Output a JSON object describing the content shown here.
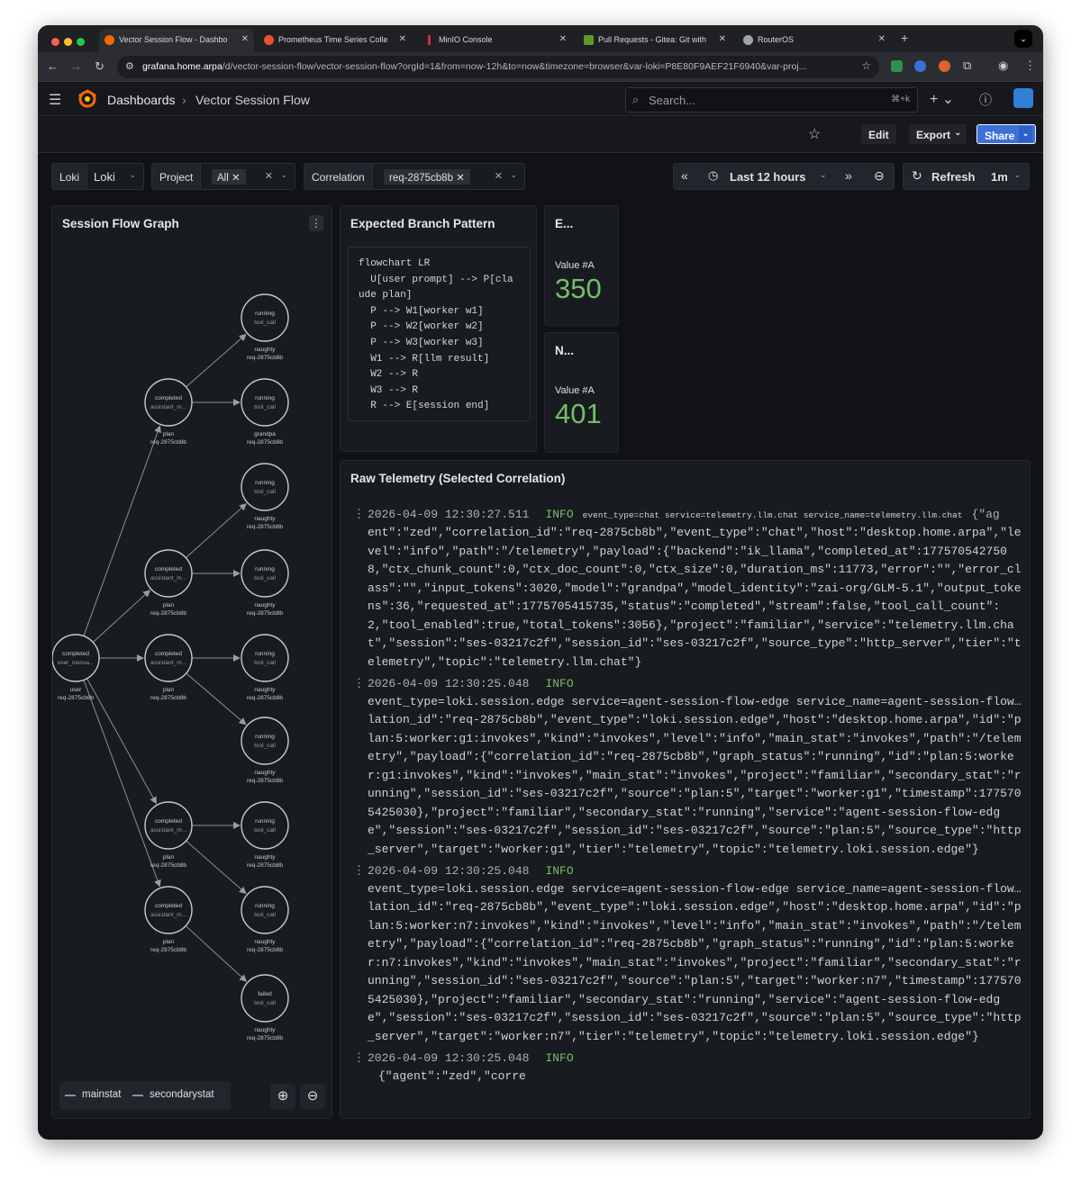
{
  "browser": {
    "tabs": [
      {
        "title": "Vector Session Flow - Dashbo",
        "color": "#f46800"
      },
      {
        "title": "Prometheus Time Series Colle",
        "color": "#e6522c"
      },
      {
        "title": "MinIO Console",
        "color": "#c72c48"
      },
      {
        "title": "Pull Requests - Gitea: Git with",
        "color": "#609926"
      },
      {
        "title": "RouterOS",
        "color": "#9ea3ad"
      }
    ],
    "url_host": "grafana.home.arpa",
    "url_rest": "/d/vector-session-flow/vector-session-flow?orgId=1&from=now-12h&to=now&timezone=browser&var-loki=P8E80F9AEF21F6940&var-proj..."
  },
  "header": {
    "breadcrumb_root": "Dashboards",
    "breadcrumb_current": "Vector Session Flow",
    "search_placeholder": "Search...",
    "search_shortcut": "⌘+k"
  },
  "toolbar": {
    "edit": "Edit",
    "export": "Export",
    "share": "Share"
  },
  "variables": {
    "loki": {
      "label": "Loki",
      "value": "Loki"
    },
    "project": {
      "label": "Project",
      "value": "All"
    },
    "correlation": {
      "label": "Correlation",
      "value": "req-2875cb8b"
    }
  },
  "timepicker": {
    "range": "Last 12 hours",
    "refresh": "Refresh",
    "interval": "1m"
  },
  "graph_panel": {
    "title": "Session Flow Graph",
    "nodes": [
      {
        "id": "user",
        "main": "completed",
        "sec": "user_messa...",
        "title": "user",
        "sub": "req-2875cb8b"
      },
      {
        "id": "a1",
        "main": "completed",
        "sec": "assistant_m...",
        "title": "plan",
        "sub": "req-2875cb8b"
      },
      {
        "id": "a2",
        "main": "completed",
        "sec": "assistant_m...",
        "title": "plan",
        "sub": "req-2875cb8b"
      },
      {
        "id": "a3",
        "main": "completed",
        "sec": "assistant_m...",
        "title": "plan",
        "sub": "req-2875cb8b"
      },
      {
        "id": "a4",
        "main": "completed",
        "sec": "assistant_m...",
        "title": "plan",
        "sub": "req-2875cb8b"
      },
      {
        "id": "a5",
        "main": "completed",
        "sec": "assistant_m...",
        "title": "plan",
        "sub": "req-2875cb8b"
      },
      {
        "id": "t1",
        "main": "running",
        "sec": "tool_call",
        "title": "naughty",
        "sub": "req-2875cb8b"
      },
      {
        "id": "t2",
        "main": "running",
        "sec": "tool_call",
        "title": "grandpa",
        "sub": "req-2875cb8b"
      },
      {
        "id": "t3",
        "main": "running",
        "sec": "tool_call",
        "title": "naughty",
        "sub": "req-2875cb8b"
      },
      {
        "id": "t4",
        "main": "running",
        "sec": "tool_call",
        "title": "naughty",
        "sub": "req-2875cb8b"
      },
      {
        "id": "t5",
        "main": "running",
        "sec": "tool_call",
        "title": "naughty",
        "sub": "req-2875cb8b"
      },
      {
        "id": "t6",
        "main": "running",
        "sec": "tool_call",
        "title": "naughty",
        "sub": "req-2875cb8b"
      },
      {
        "id": "t7",
        "main": "running",
        "sec": "tool_call",
        "title": "naughty",
        "sub": "req-2875cb8b"
      },
      {
        "id": "t8",
        "main": "running",
        "sec": "tool_call",
        "title": "naughty",
        "sub": "req-2875cb8b"
      },
      {
        "id": "t9",
        "main": "failed",
        "sec": "tool_call",
        "title": "naughty",
        "sub": "req-2875cb8b"
      }
    ],
    "edges": [
      [
        "user",
        "a1"
      ],
      [
        "user",
        "a2"
      ],
      [
        "user",
        "a3"
      ],
      [
        "user",
        "a4"
      ],
      [
        "user",
        "a5"
      ],
      [
        "a1",
        "t1"
      ],
      [
        "a1",
        "t2"
      ],
      [
        "a2",
        "t3"
      ],
      [
        "a2",
        "t4"
      ],
      [
        "a3",
        "t5"
      ],
      [
        "a3",
        "t6"
      ],
      [
        "a4",
        "t7"
      ],
      [
        "a4",
        "t8"
      ],
      [
        "a5",
        "t9"
      ]
    ],
    "legend": [
      "mainstat",
      "secondarystat"
    ]
  },
  "pattern_panel": {
    "title": "Expected Branch Pattern",
    "code": "flowchart LR\n  U[user prompt] --> P[cla\nude plan]\n  P --> W1[worker w1]\n  P --> W2[worker w2]\n  P --> W3[worker w3]\n  W1 --> R[llm result]\n  W2 --> R\n  W3 --> R\n  R --> E[session end]"
  },
  "stat_panels": [
    {
      "title": "E...",
      "label": "Value #A",
      "value": "350"
    },
    {
      "title": "N...",
      "label": "Value #A",
      "value": "401"
    }
  ],
  "logs_panel": {
    "title": "Raw Telemetry (Selected Correlation)",
    "entries": [
      {
        "ts": "2026-04-09 12:30:27.511",
        "level": "INFO",
        "labels": "event_type=chat service=telemetry.llm.chat service_name=telemetry.llm.chat",
        "lead": "{\"ag",
        "body": "ent\":\"zed\",\"correlation_id\":\"req-2875cb8b\",\"event_type\":\"chat\",\"host\":\"desktop.home.arpa\",\"level\":\"info\",\"path\":\"/telemetry\",\"payload\":{\"backend\":\"ik_llama\",\"completed_at\":1775705427508,\"ctx_chunk_count\":0,\"ctx_doc_count\":0,\"ctx_size\":0,\"duration_ms\":11773,\"error\":\"\",\"error_class\":\"\",\"input_tokens\":3020,\"model\":\"grandpa\",\"model_identity\":\"zai-org/GLM-5.1\",\"output_tokens\":36,\"requested_at\":1775705415735,\"status\":\"completed\",\"stream\":false,\"tool_call_count\":2,\"tool_enabled\":true,\"total_tokens\":3056},\"project\":\"familiar\",\"service\":\"telemetry.llm.chat\",\"session\":\"ses-03217c2f\",\"session_id\":\"ses-03217c2f\",\"source_type\":\"http_server\",\"tier\":\"telemetry\",\"topic\":\"telemetry.llm.chat\"}"
      },
      {
        "ts": "2026-04-09 12:30:25.048",
        "level": "INFO",
        "labels": "event_type=loki.session.edge service=agent-session-flow-edge service_name=agent-session-flow…",
        "lead": "{\"agent\":\"zed\",\"corre",
        "body": "lation_id\":\"req-2875cb8b\",\"event_type\":\"loki.session.edge\",\"host\":\"desktop.home.arpa\",\"id\":\"plan:5:worker:g1:invokes\",\"kind\":\"invokes\",\"level\":\"info\",\"main_stat\":\"invokes\",\"path\":\"/telemetry\",\"payload\":{\"correlation_id\":\"req-2875cb8b\",\"graph_status\":\"running\",\"id\":\"plan:5:worker:g1:invokes\",\"kind\":\"invokes\",\"main_stat\":\"invokes\",\"project\":\"familiar\",\"secondary_stat\":\"running\",\"session_id\":\"ses-03217c2f\",\"source\":\"plan:5\",\"target\":\"worker:g1\",\"timestamp\":1775705425030},\"project\":\"familiar\",\"secondary_stat\":\"running\",\"service\":\"agent-session-flow-edge\",\"session\":\"ses-03217c2f\",\"session_id\":\"ses-03217c2f\",\"source\":\"plan:5\",\"source_type\":\"http_server\",\"target\":\"worker:g1\",\"tier\":\"telemetry\",\"topic\":\"telemetry.loki.session.edge\"}"
      },
      {
        "ts": "2026-04-09 12:30:25.048",
        "level": "INFO",
        "labels": "event_type=loki.session.edge service=agent-session-flow-edge service_name=agent-session-flow…",
        "lead": "{\"agent\":\"zed\",\"corre",
        "body": "lation_id\":\"req-2875cb8b\",\"event_type\":\"loki.session.edge\",\"host\":\"desktop.home.arpa\",\"id\":\"plan:5:worker:n7:invokes\",\"kind\":\"invokes\",\"level\":\"info\",\"main_stat\":\"invokes\",\"path\":\"/telemetry\",\"payload\":{\"correlation_id\":\"req-2875cb8b\",\"graph_status\":\"running\",\"id\":\"plan:5:worker:n7:invokes\",\"kind\":\"invokes\",\"main_stat\":\"invokes\",\"project\":\"familiar\",\"secondary_stat\":\"running\",\"session_id\":\"ses-03217c2f\",\"source\":\"plan:5\",\"target\":\"worker:n7\",\"timestamp\":1775705425030},\"project\":\"familiar\",\"secondary_stat\":\"running\",\"service\":\"agent-session-flow-edge\",\"session\":\"ses-03217c2f\",\"session_id\":\"ses-03217c2f\",\"source\":\"plan:5\",\"source_type\":\"http_server\",\"target\":\"worker:n7\",\"tier\":\"telemetry\",\"topic\":\"telemetry.loki.session.edge\"}"
      },
      {
        "ts": "2026-04-09 12:30:25.048",
        "level": "INFO",
        "labels": "",
        "lead": "{\"agent\":\"zed\",\"corre",
        "body": ""
      }
    ]
  },
  "colors": {
    "accent": "#f46800",
    "stat_green": "#73bf69",
    "share_blue": "#3d71d9"
  }
}
